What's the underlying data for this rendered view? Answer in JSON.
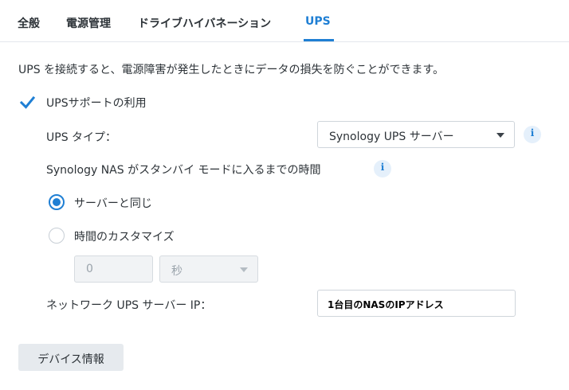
{
  "tabs": [
    {
      "label": "全般"
    },
    {
      "label": "電源管理"
    },
    {
      "label": "ドライブハイバネーション"
    },
    {
      "label": "UPS"
    }
  ],
  "active_tab": "UPS",
  "description": "UPS を接続すると、電源障害が発生したときにデータの損失を防ぐことができます。",
  "ups_support": {
    "label": "UPSサポートの利用",
    "checked": true
  },
  "ups_type": {
    "label": "UPS タイプ：",
    "value": "Synology UPS サーバー"
  },
  "standby_time": {
    "label": "Synology NAS がスタンバイ モードに入るまでの時間"
  },
  "radio_same": {
    "label": "サーバーと同じ",
    "checked": true
  },
  "radio_custom": {
    "label": "時間のカスタマイズ",
    "checked": false
  },
  "custom_time": {
    "value": "0",
    "unit": "秒"
  },
  "network_ups_ip": {
    "label": "ネットワーク UPS サーバー IP：",
    "value": "1台目のNASのIPアドレス"
  },
  "device_info_button": "デバイス情報",
  "colors": {
    "accent": "#1f7fd4",
    "text": "#2d3338"
  },
  "icons": {
    "checkbox": "checkmark-icon",
    "info": "info-icon",
    "caret": "caret-down-icon"
  }
}
